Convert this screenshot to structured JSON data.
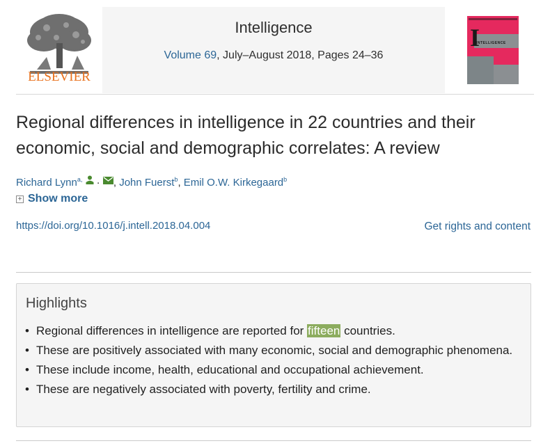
{
  "header": {
    "publisher": "ELSEVIER",
    "journal_title": "Intelligence",
    "volume_label": "Volume",
    "volume_number": "69",
    "issue_meta": ", July–August 2018, Pages 24–36",
    "cover_letter": "I",
    "cover_title": "INTELLIGENCE"
  },
  "article": {
    "title": "Regional differences in intelligence in 22 countries and their economic, social and demographic correlates: A review",
    "authors": [
      {
        "name": "Richard Lynn",
        "sup": "a,"
      },
      {
        "name": "John Fuerst",
        "sup": "b"
      },
      {
        "name": "Emil O.W. Kirkegaard",
        "sup": "b"
      }
    ],
    "show_more": "Show more",
    "doi": "https://doi.org/10.1016/j.intell.2018.04.004",
    "rights": "Get rights and content"
  },
  "highlights": {
    "heading": "Highlights",
    "item1_before": "Regional differences in intelligence are reported for",
    "item1_mark": "fifteen",
    "item1_after": "countries.",
    "item2": "These are positively associated with many economic, social and demographic phenomena.",
    "item3": "These include income, health, educational and occupational achievement.",
    "item4": "These are negatively associated with poverty, fertility and crime."
  },
  "colors": {
    "link": "#2c6696",
    "brand": "#e9711c",
    "highlight": "#8cac5e"
  }
}
